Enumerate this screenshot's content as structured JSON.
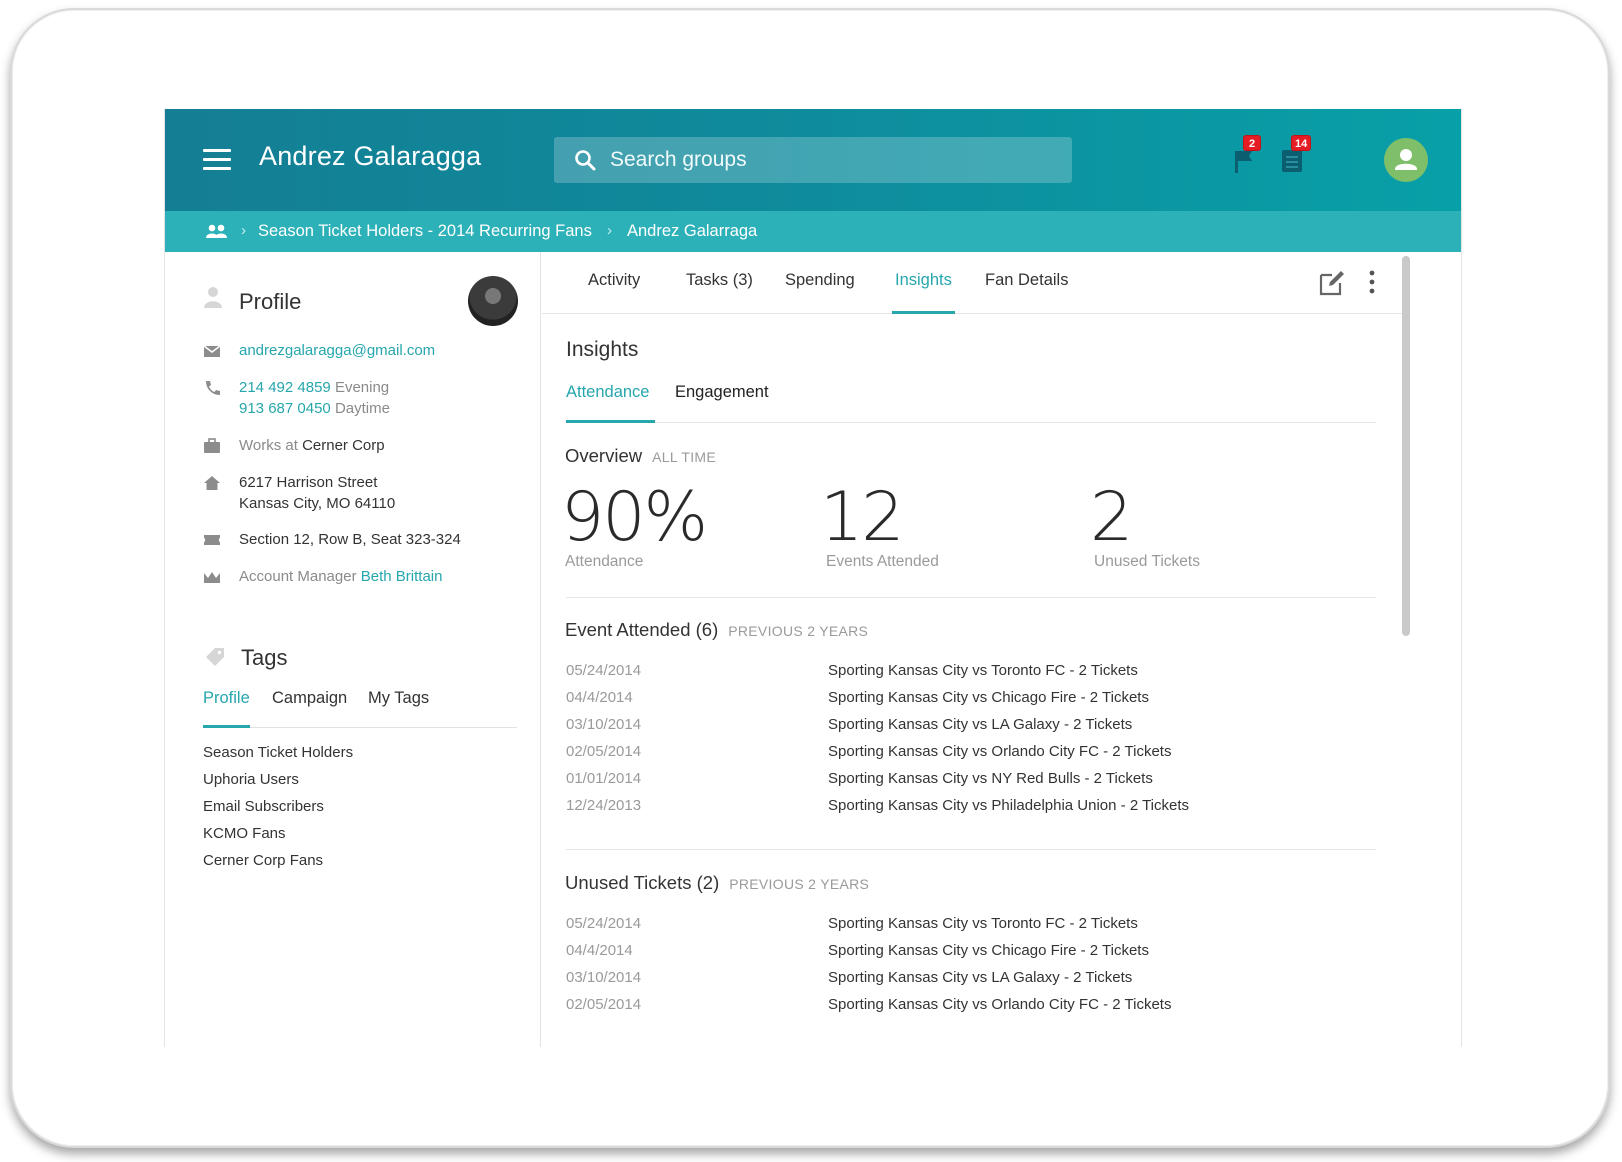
{
  "header": {
    "title": "Andrez Galaragga",
    "search_placeholder": "Search groups",
    "flag_badge": "2",
    "list_badge": "14"
  },
  "breadcrumb": {
    "group": "Season Ticket Holders - 2014 Recurring Fans",
    "current": "Andrez Galarraga"
  },
  "profile": {
    "title": "Profile",
    "email": "andrezgalaragga@gmail.com",
    "phone1": "214 492 4859",
    "phone1_label": "Evening",
    "phone2": "913 687 0450",
    "phone2_label": "Daytime",
    "works_at_label": "Works at",
    "employer": "Cerner Corp",
    "address_line1": "6217 Harrison Street",
    "address_line2": "Kansas City, MO 64110",
    "seat": "Section 12, Row B, Seat 323-324",
    "account_manager_label": "Account Manager",
    "account_manager": "Beth Brittain"
  },
  "tags": {
    "title": "Tags",
    "tabs": [
      "Profile",
      "Campaign",
      "My Tags"
    ],
    "items": [
      "Season Ticket Holders",
      "Uphoria Users",
      "Email Subscribers",
      "KCMO Fans",
      "Cerner Corp Fans"
    ]
  },
  "tabs": [
    "Activity",
    "Tasks (3)",
    "Spending",
    "Insights",
    "Fan Details"
  ],
  "insights": {
    "title": "Insights",
    "subtabs": [
      "Attendance",
      "Engagement"
    ],
    "overview": {
      "title": "Overview",
      "period": "ALL TIME",
      "attendance": "90%",
      "attendance_label": "Attendance",
      "events": "12",
      "events_label": "Events Attended",
      "unused": "2",
      "unused_label": "Unused Tickets"
    },
    "events_attended": {
      "title": "Event Attended (6)",
      "period": "PREVIOUS 2 YEARS",
      "rows": [
        {
          "date": "05/24/2014",
          "event": "Sporting Kansas City vs Toronto FC - 2 Tickets"
        },
        {
          "date": "04/4/2014",
          "event": "Sporting Kansas City vs Chicago Fire - 2 Tickets"
        },
        {
          "date": "03/10/2014",
          "event": "Sporting Kansas City vs LA Galaxy - 2 Tickets"
        },
        {
          "date": "02/05/2014",
          "event": "Sporting Kansas City vs Orlando City FC - 2 Tickets"
        },
        {
          "date": "01/01/2014",
          "event": "Sporting Kansas City vs NY Red Bulls - 2 Tickets"
        },
        {
          "date": "12/24/2013",
          "event": "Sporting Kansas City vs Philadelphia Union - 2 Tickets"
        }
      ]
    },
    "unused_tickets": {
      "title": "Unused Tickets (2)",
      "period": "PREVIOUS 2 YEARS",
      "rows": [
        {
          "date": "05/24/2014",
          "event": "Sporting Kansas City vs Toronto FC - 2 Tickets"
        },
        {
          "date": "04/4/2014",
          "event": "Sporting Kansas City vs Chicago Fire - 2 Tickets"
        },
        {
          "date": "03/10/2014",
          "event": "Sporting Kansas City vs LA Galaxy - 2 Tickets"
        },
        {
          "date": "02/05/2014",
          "event": "Sporting Kansas City vs Orlando City FC - 2 Tickets"
        }
      ]
    }
  },
  "colors": {
    "accent": "#26a6ad",
    "header": "#0f8a9c",
    "breadcrumb": "#2db1b9",
    "badge": "#e51c23",
    "avatar": "#7fbf6a"
  }
}
